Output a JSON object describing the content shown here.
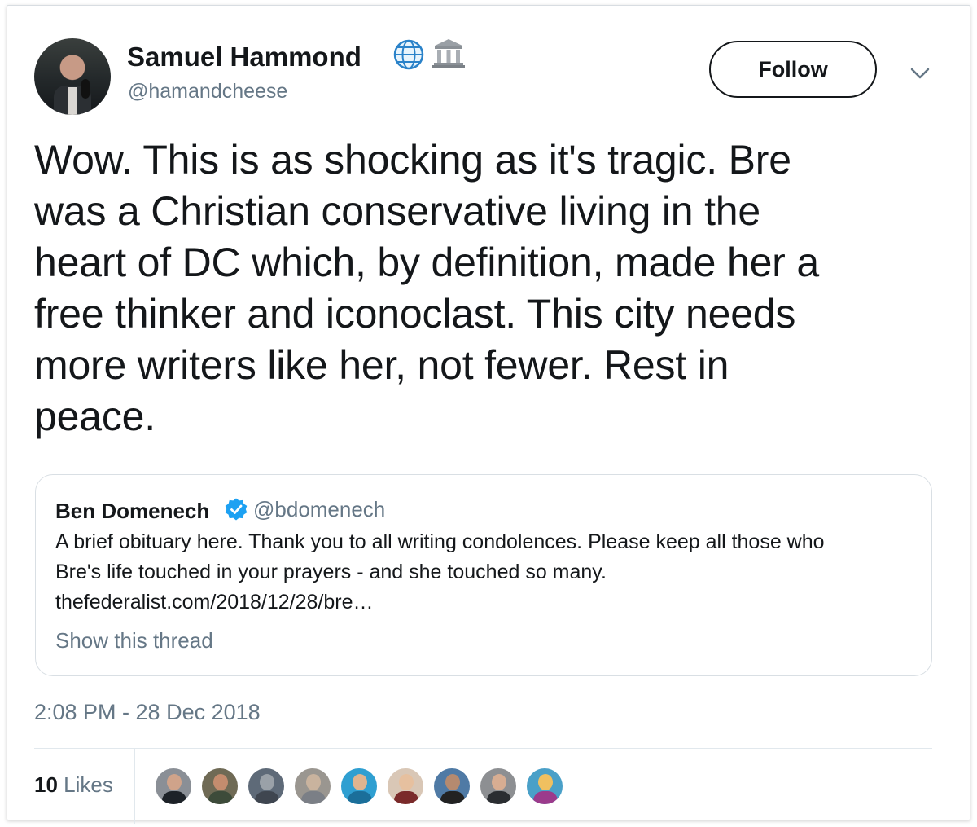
{
  "tweet": {
    "author": {
      "name": "Samuel Hammond",
      "handle": "@hamandcheese",
      "badges": [
        "globe-icon",
        "classical-building-icon"
      ]
    },
    "follow_label": "Follow",
    "text_lines": [
      "Wow. This is as shocking as it's tragic. Bre",
      "was a Christian conservative living in the",
      "heart of DC which, by definition, made her a",
      "free thinker and iconoclast. This city needs",
      "more writers like her, not fewer. Rest in",
      "peace."
    ],
    "quoted": {
      "name": "Ben Domenech",
      "handle": "@bdomenech",
      "verified": true,
      "text_lines": [
        "A brief obituary here. Thank you to all writing condolences. Please keep all those who",
        "Bre's life touched in your prayers - and she touched so many.",
        "thefederalist.com/2018/12/28/bre…"
      ],
      "show_thread": "Show this thread"
    },
    "timestamp": "2:08 PM - 28 Dec 2018",
    "likes": {
      "count": "10",
      "label": "Likes"
    }
  },
  "likers": [
    {
      "bg": "#8a8f96",
      "head": "#cfa38a",
      "body": "#1d2228"
    },
    {
      "bg": "#6f6a55",
      "head": "#c48c6e",
      "body": "#3d4b3a"
    },
    {
      "bg": "#5e6a78",
      "head": "#9aa1a8",
      "body": "#3f4650"
    },
    {
      "bg": "#9a9690",
      "head": "#c9b39e",
      "body": "#7b7f86"
    },
    {
      "bg": "#2f9fd1",
      "head": "#e0b48f",
      "body": "#1b6f9a"
    },
    {
      "bg": "#d9c7b6",
      "head": "#e6c09f",
      "body": "#7a2a2a"
    },
    {
      "bg": "#4f7aa5",
      "head": "#b58a6f",
      "body": "#222222"
    },
    {
      "bg": "#8d8f92",
      "head": "#d7ad92",
      "body": "#2a2d31"
    },
    {
      "bg": "#4aa0c8",
      "head": "#f0c060",
      "body": "#9b3b8c"
    }
  ],
  "colors": {
    "text": "#14171a",
    "secondary": "#657786",
    "border": "#e1e8ed",
    "verified": "#1da1f2"
  }
}
